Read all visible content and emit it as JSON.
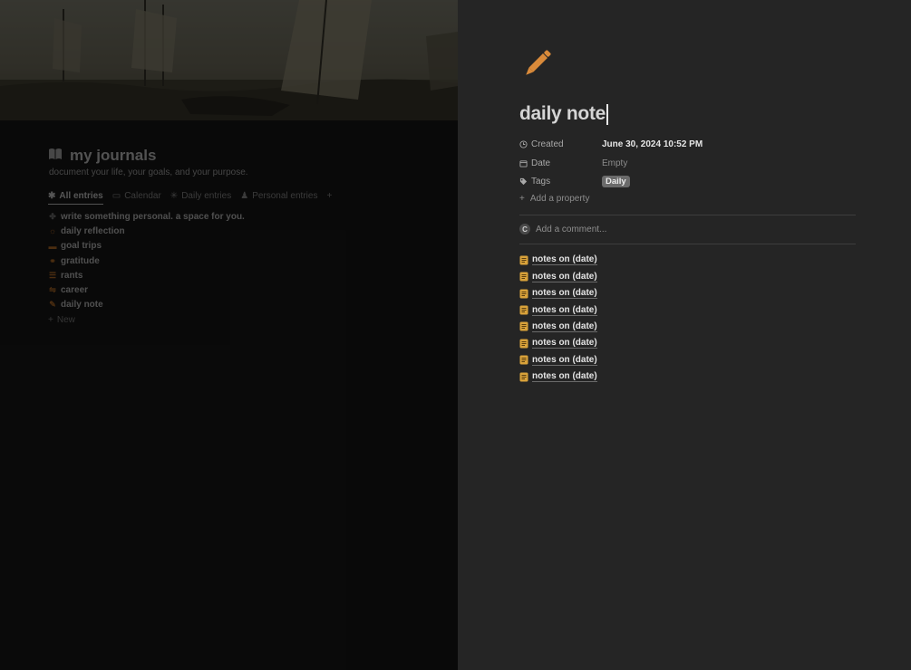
{
  "left_page": {
    "title": "my journals",
    "description": "document your life, your goals, and your purpose.",
    "tabs": [
      {
        "label": "All entries",
        "icon": "asterisk-icon",
        "active": true
      },
      {
        "label": "Calendar",
        "icon": "calendar-icon",
        "active": false
      },
      {
        "label": "Daily entries",
        "icon": "sparkle-icon",
        "active": false
      },
      {
        "label": "Personal entries",
        "icon": "person-icon",
        "active": false
      }
    ],
    "add_tab_symbol": "+",
    "items": [
      {
        "label": "write something personal. a space for you.",
        "icon": "pin-icon",
        "icon_color": "#7c7c7c"
      },
      {
        "label": "daily reflection",
        "icon": "sun-icon",
        "icon_color": "#c4762b"
      },
      {
        "label": "goal trips",
        "icon": "suitcase-icon",
        "icon_color": "#c4762b"
      },
      {
        "label": "gratitude",
        "icon": "link-icon",
        "icon_color": "#c4762b"
      },
      {
        "label": "rants",
        "icon": "list-icon",
        "icon_color": "#c4762b"
      },
      {
        "label": "career",
        "icon": "handshake-icon",
        "icon_color": "#c4762b"
      },
      {
        "label": "daily note",
        "icon": "pencil-icon",
        "icon_color": "#c4762b"
      }
    ],
    "new_label": "New",
    "new_symbol": "+"
  },
  "peek": {
    "icon": "pencil-icon",
    "icon_color": "#d98a3a",
    "title": "daily note",
    "properties": [
      {
        "name": "Created",
        "icon": "clock-icon",
        "value": "June 30, 2024 10:52 PM"
      },
      {
        "name": "Date",
        "icon": "calendar-icon",
        "value": "Empty"
      },
      {
        "name": "Tags",
        "icon": "tag-icon",
        "value": "Daily"
      }
    ],
    "add_property_label": "Add a property",
    "add_property_symbol": "+",
    "comment_avatar": "C",
    "comment_placeholder": "Add a comment...",
    "notes": [
      "notes on (date)",
      "notes on (date)",
      "notes on (date)",
      "notes on (date)",
      "notes on (date)",
      "notes on (date)",
      "notes on (date)",
      "notes on (date)"
    ],
    "note_icon": "page-icon",
    "note_icon_color": "#d9a23a"
  }
}
